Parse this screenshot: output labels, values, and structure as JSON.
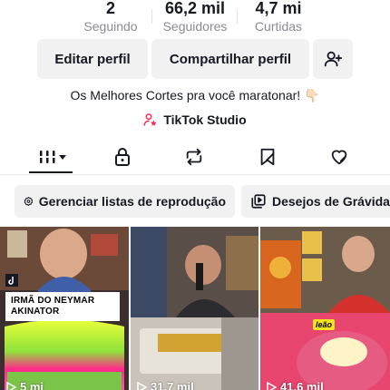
{
  "stats": {
    "following": {
      "value": "2",
      "label": "Seguindo"
    },
    "followers": {
      "value": "66,2 mil",
      "label": "Seguidores"
    },
    "likes": {
      "value": "4,7 mi",
      "label": "Curtidas"
    }
  },
  "actions": {
    "edit_label": "Editar perfil",
    "share_label": "Compartilhar perfil",
    "add_friend_icon": "add-user-icon"
  },
  "bio": {
    "text": "Os Melhores Cortes pra você maratonar! 👇🏻",
    "studio_label": "TikTok Studio",
    "studio_icon": "person-star-icon",
    "studio_icon_color": "#fe2c55"
  },
  "tabs": [
    {
      "name": "videos",
      "icon": "grid-icon",
      "active": true
    },
    {
      "name": "private",
      "icon": "lock-icon"
    },
    {
      "name": "reposts",
      "icon": "repost-icon"
    },
    {
      "name": "favorites",
      "icon": "bookmark-icon"
    },
    {
      "name": "liked",
      "icon": "heart-icon"
    }
  ],
  "playlists": [
    {
      "label": "Gerenciar listas de reprodução",
      "icon": "gear-icon"
    },
    {
      "label": "Desejos de Grávida",
      "icon": "playlist-icon"
    }
  ],
  "videos": [
    {
      "views": "5 mi",
      "caption": "IRMÃ DO NEYMAR AKINATOR",
      "badge_icon": "tiktok-icon"
    },
    {
      "views": "31,7 mil"
    },
    {
      "views": "41,6 mil",
      "tag": "leão"
    }
  ],
  "colors": {
    "text": "#161823",
    "muted": "#8a8b91",
    "button_bg": "#f1f1f2",
    "accent": "#fe2c55"
  }
}
